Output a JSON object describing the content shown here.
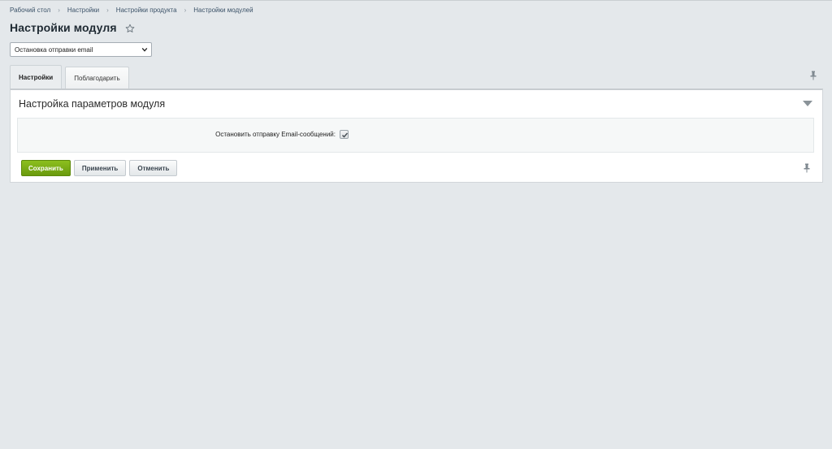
{
  "breadcrumb": {
    "items": [
      "Рабочий стол",
      "Настройки",
      "Настройки продукта",
      "Настройки модулей"
    ],
    "separator": "›"
  },
  "page": {
    "title": "Настройки модуля"
  },
  "module_select": {
    "selected": "Остановка отправки email"
  },
  "tabs": [
    {
      "label": "Настройки",
      "active": true
    },
    {
      "label": "Поблагодарить",
      "active": false
    }
  ],
  "panel": {
    "header": "Настройка параметров модуля",
    "fields": [
      {
        "label": "Остановить отправку Email-сообщений:",
        "checked": true
      }
    ]
  },
  "buttons": {
    "save": "Сохранить",
    "apply": "Применить",
    "cancel": "Отменить"
  },
  "colors": {
    "background": "#e4e8eb",
    "save_button": "#7aad16",
    "link": "#3b5268"
  },
  "icons": [
    "star-icon",
    "chevron-down-icon",
    "pin-icon",
    "collapse-arrow-icon",
    "checkmark-icon"
  ]
}
